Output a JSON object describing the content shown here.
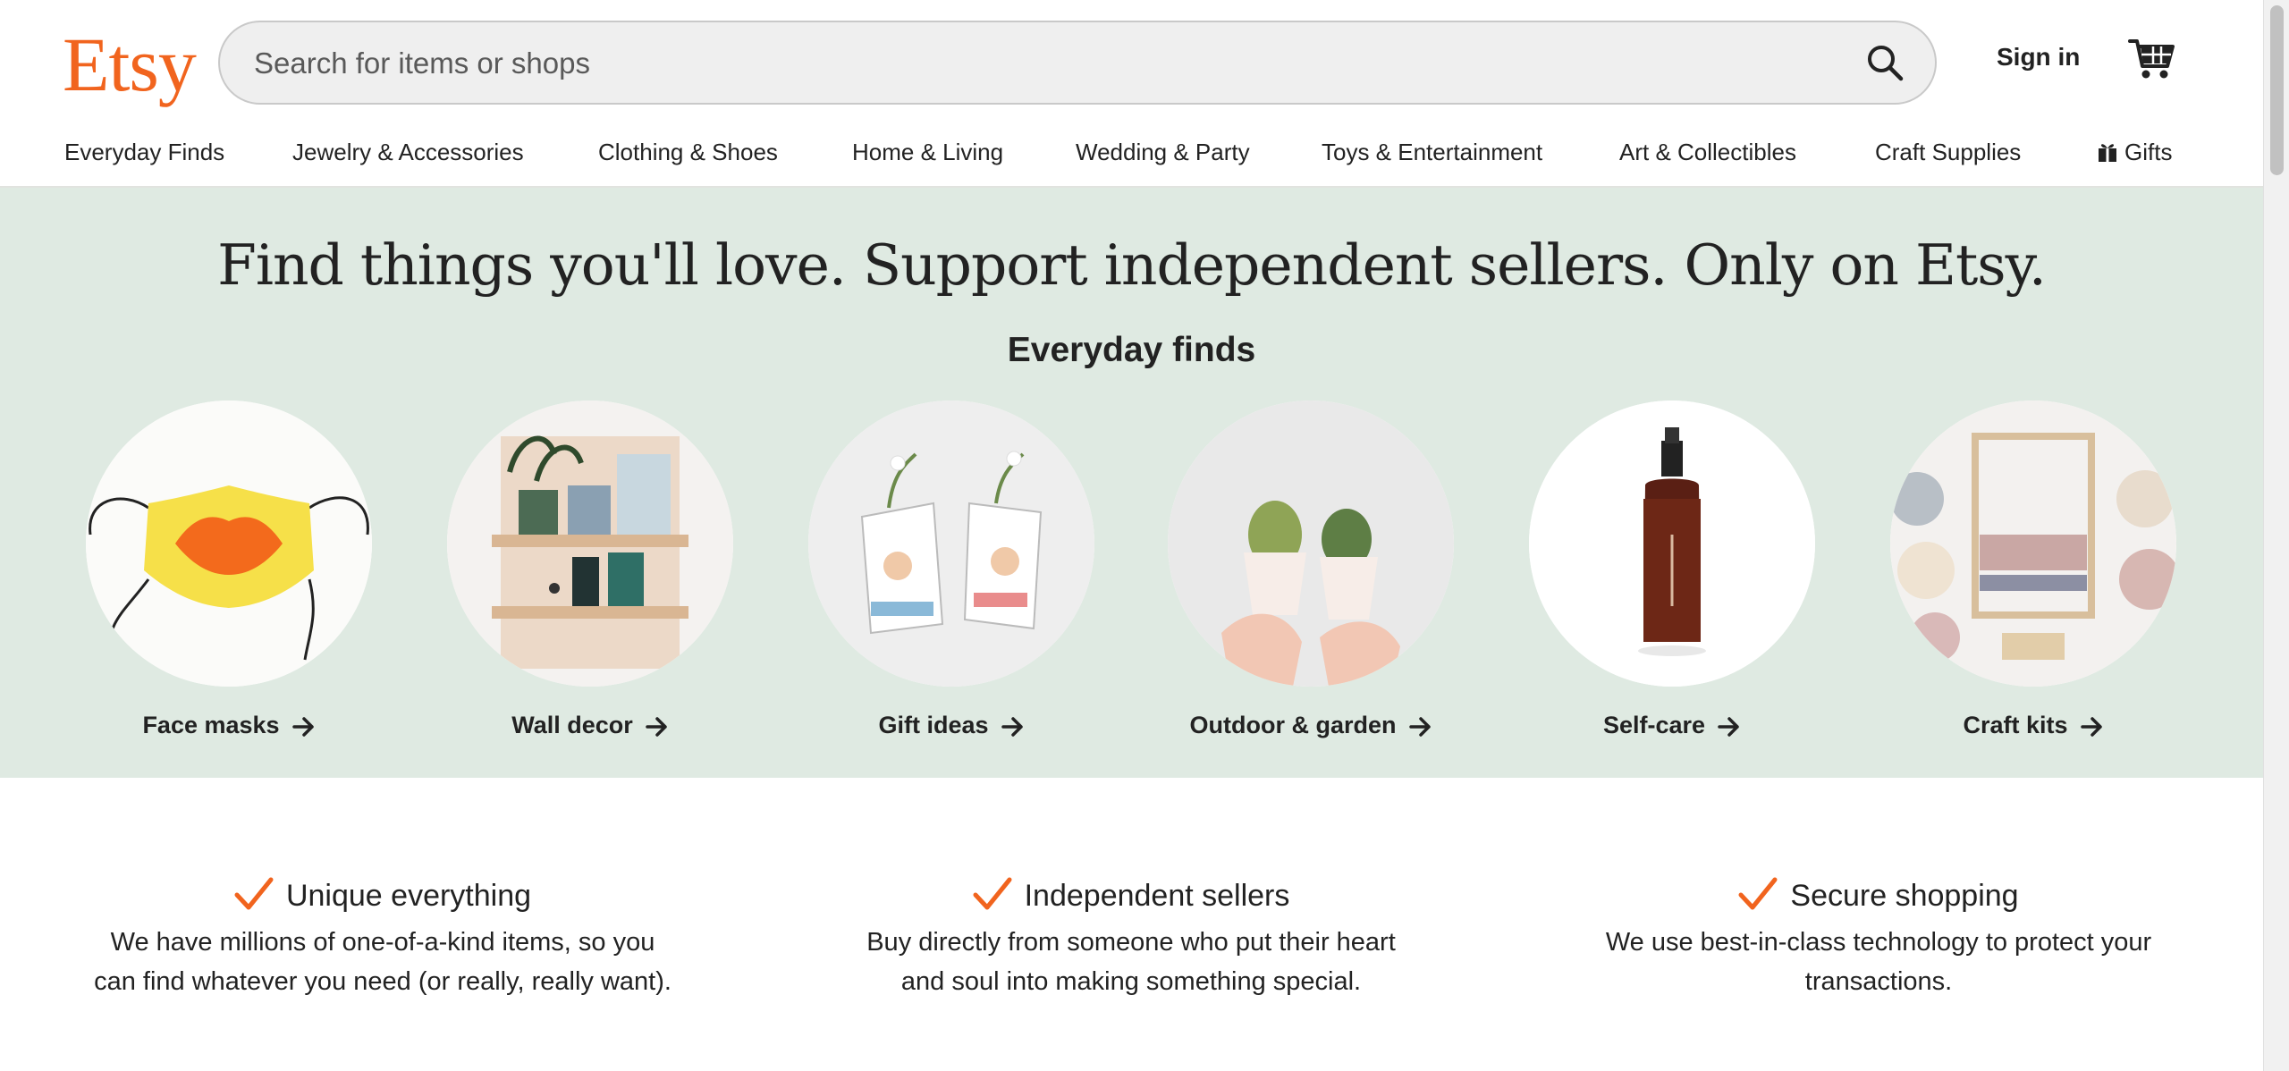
{
  "header": {
    "logo": "Etsy",
    "search_placeholder": "Search for items or shops",
    "search_icon": "search-icon",
    "signin_label": "Sign in",
    "cart_icon": "cart-icon",
    "nav": [
      {
        "label": "Everyday Finds"
      },
      {
        "label": "Jewelry & Accessories"
      },
      {
        "label": "Clothing & Shoes"
      },
      {
        "label": "Home & Living"
      },
      {
        "label": "Wedding & Party"
      },
      {
        "label": "Toys & Entertainment"
      },
      {
        "label": "Art & Collectibles"
      },
      {
        "label": "Craft Supplies"
      },
      {
        "label": "Gifts",
        "icon": "gift-icon"
      }
    ]
  },
  "hero": {
    "title": "Find things you'll love. Support independent sellers. Only on Etsy.",
    "subtitle": "Everyday finds",
    "background_color": "#dfeae2",
    "categories": [
      {
        "label": "Face masks",
        "icon": "arrow-right-icon"
      },
      {
        "label": "Wall decor",
        "icon": "arrow-right-icon"
      },
      {
        "label": "Gift ideas",
        "icon": "arrow-right-icon"
      },
      {
        "label": "Outdoor & garden",
        "icon": "arrow-right-icon"
      },
      {
        "label": "Self-care",
        "icon": "arrow-right-icon"
      },
      {
        "label": "Craft kits",
        "icon": "arrow-right-icon"
      }
    ]
  },
  "value_props": [
    {
      "title": "Unique everything",
      "text_line1": "We have millions of one-of-a-kind items, so you",
      "text_line2": "can find whatever you need (or really, really want).",
      "icon": "checkmark-icon"
    },
    {
      "title": "Independent sellers",
      "text_line1": "Buy directly from someone who put their heart",
      "text_line2": "and soul into making something special.",
      "icon": "checkmark-icon"
    },
    {
      "title": "Secure shopping",
      "text_line1": "We use best-in-class technology to protect your",
      "text_line2": "transactions.",
      "icon": "checkmark-icon"
    }
  ],
  "colors": {
    "brand": "#f1641e",
    "text": "#222222"
  }
}
